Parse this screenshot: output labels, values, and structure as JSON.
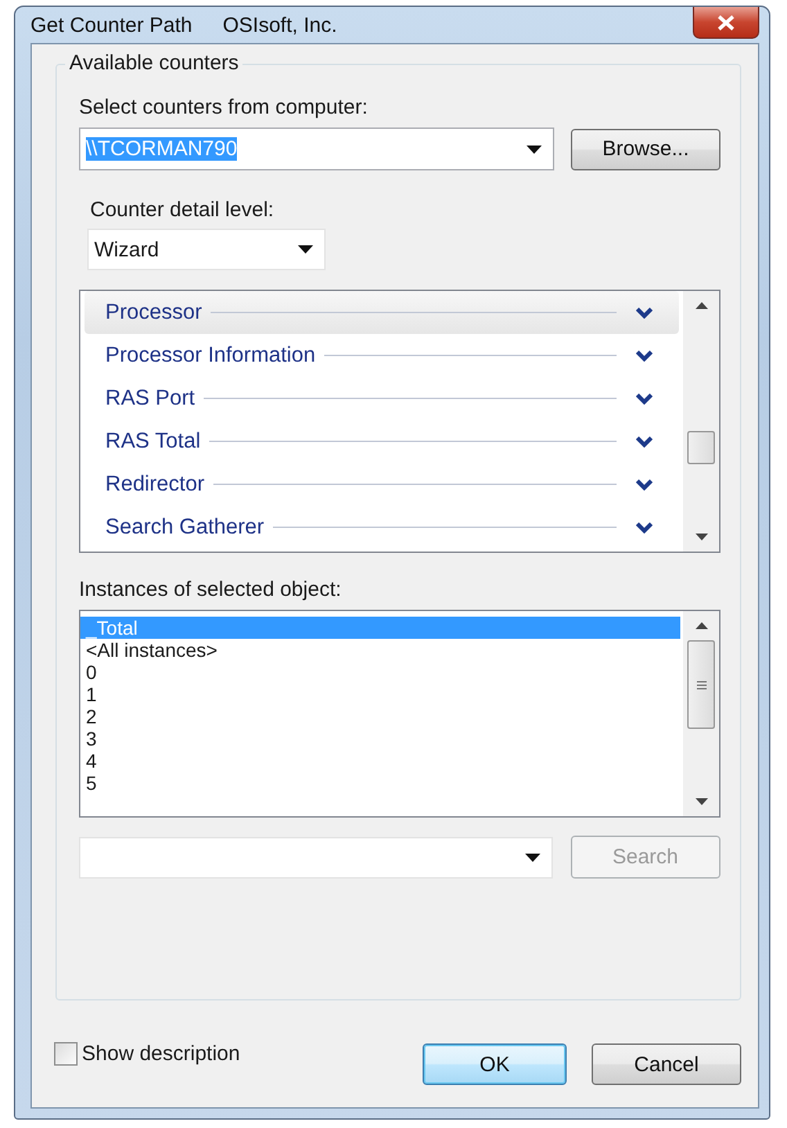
{
  "window": {
    "title": "Get Counter Path",
    "subtitle": "OSIsoft, Inc."
  },
  "group": {
    "label": "Available counters"
  },
  "computer": {
    "label": "Select counters from computer:",
    "value": "\\\\TCORMAN790",
    "text_selected": true
  },
  "browse_button": {
    "label": "Browse...",
    "disabled": false
  },
  "detail_level": {
    "label": "Counter detail level:",
    "value": "Wizard"
  },
  "objects": [
    {
      "name": "Processor",
      "selected": true
    },
    {
      "name": "Processor Information",
      "selected": false
    },
    {
      "name": "RAS Port",
      "selected": false
    },
    {
      "name": "RAS Total",
      "selected": false
    },
    {
      "name": "Redirector",
      "selected": false
    },
    {
      "name": "Search Gatherer",
      "selected": false
    }
  ],
  "instances": {
    "label": "Instances of selected object:",
    "items": [
      {
        "name": "_Total",
        "selected": true
      },
      {
        "name": "<All instances>",
        "selected": false
      },
      {
        "name": "0",
        "selected": false
      },
      {
        "name": "1",
        "selected": false
      },
      {
        "name": "2",
        "selected": false
      },
      {
        "name": "3",
        "selected": false
      },
      {
        "name": "4",
        "selected": false
      },
      {
        "name": "5",
        "selected": false
      }
    ]
  },
  "search_button": {
    "label": "Search",
    "disabled": true
  },
  "show_description": {
    "label": "Show description",
    "checked": false
  },
  "buttons": [
    {
      "label": "OK",
      "default": true
    },
    {
      "label": "Cancel",
      "default": false
    }
  ]
}
